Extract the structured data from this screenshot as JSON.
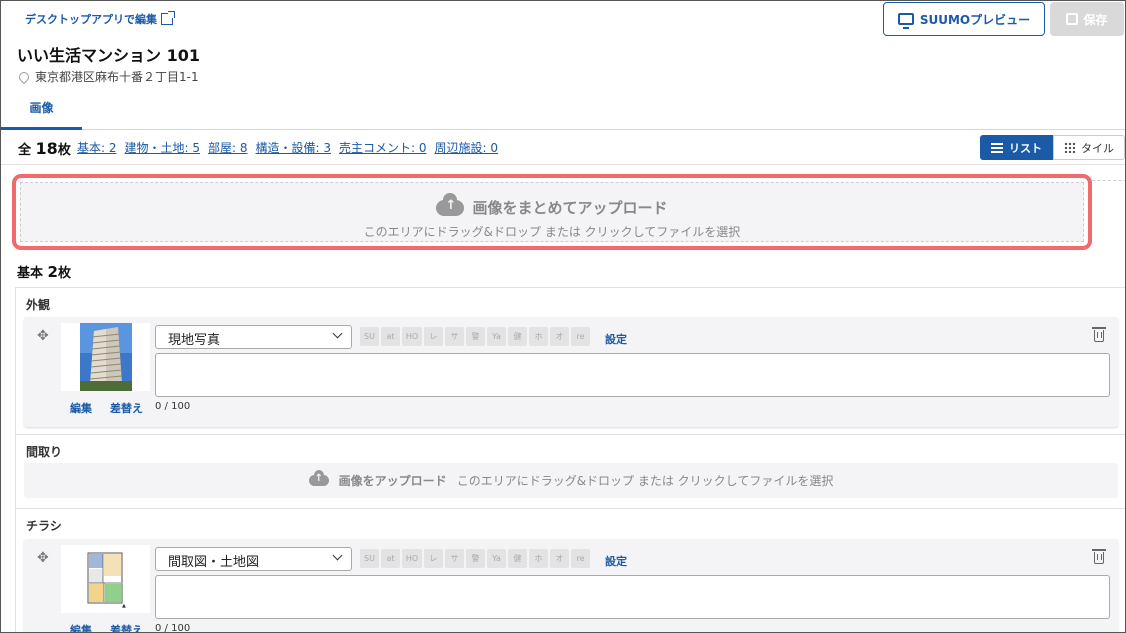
{
  "header": {
    "desktop_link": "デスクトップアプリで編集",
    "title": "いい生活マンション 101",
    "address": "東京都港区麻布十番２丁目1-1",
    "tab_image": "画像",
    "preview_button": "SUUMOプレビュー",
    "save_button": "保存"
  },
  "counts": {
    "total_prefix": "全",
    "total_number": "18",
    "total_suffix": "枚",
    "categories": [
      "基本: 2",
      "建物・土地: 5",
      "部屋: 8",
      "構造・設備: 3",
      "売主コメント: 0",
      "周辺施設: 0"
    ]
  },
  "view_toggle": {
    "list": "リスト",
    "tile": "タイル"
  },
  "bulk_upload": {
    "title": "画像をまとめてアップロード",
    "subtitle": "このエリアにドラッグ&ドロップ または クリックしてファイルを選択"
  },
  "section": {
    "name": "基本",
    "count": "2",
    "suffix": "枚"
  },
  "groups": {
    "exterior": {
      "label": "外観",
      "select_value": "現地写真",
      "edit": "編集",
      "replace": "差替え",
      "counter": "0 / 100",
      "settings": "設定"
    },
    "floorplan": {
      "label": "間取り",
      "upload_title": "画像をアップロード",
      "upload_hint": "このエリアにドラッグ&ドロップ または クリックしてファイルを選択"
    },
    "flyer": {
      "label": "チラシ",
      "select_value": "間取図・土地図",
      "edit": "編集",
      "replace": "差替え",
      "counter": "0 / 100",
      "settings": "設定"
    }
  },
  "tags": [
    "SU",
    "at",
    "HO",
    "レ",
    "サ",
    "警",
    "Ya",
    "健",
    "ホ",
    "オ",
    "re"
  ],
  "colors": {
    "accent": "#1a5aa6",
    "highlight": "#f06b6b"
  }
}
